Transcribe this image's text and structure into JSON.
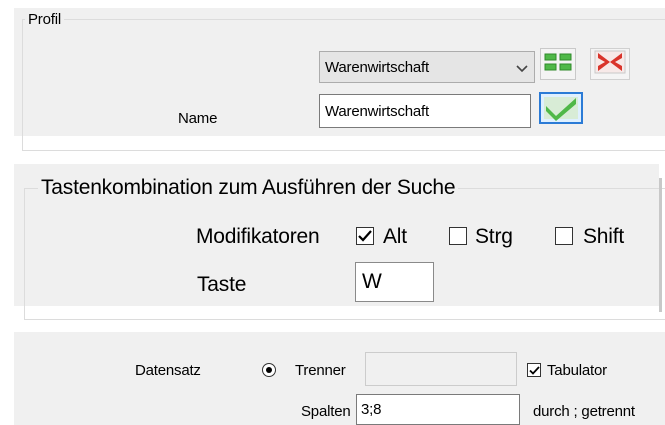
{
  "profile": {
    "group_label": "Profil",
    "profile_select": "Warenwirtschaft",
    "name_label": "Name",
    "name_value": "Warenwirtschaft",
    "icons": {
      "grid": "grid-icon",
      "delete": "delete-x-icon",
      "confirm": "checkmark-icon"
    }
  },
  "hotkey": {
    "group_label": "Tastenkombination zum Ausführen der Suche",
    "modifiers_label": "Modifikatoren",
    "modifiers": [
      {
        "label": "Alt",
        "checked": true
      },
      {
        "label": "Strg",
        "checked": false
      },
      {
        "label": "Shift",
        "checked": false
      }
    ],
    "key_label": "Taste",
    "key_value": "W"
  },
  "record": {
    "label": "Datensatz",
    "separator_label": "Trenner",
    "separator_value": "",
    "tabulator_label": "Tabulator",
    "tabulator_checked": true,
    "columns_label": "Spalten",
    "columns_value": "3;8",
    "columns_hint": "durch ; getrennt"
  },
  "colors": {
    "panel": "#f0f0f0",
    "green": "#4fb848",
    "red": "#d9342b",
    "blue_frame": "#2b7bd6"
  }
}
